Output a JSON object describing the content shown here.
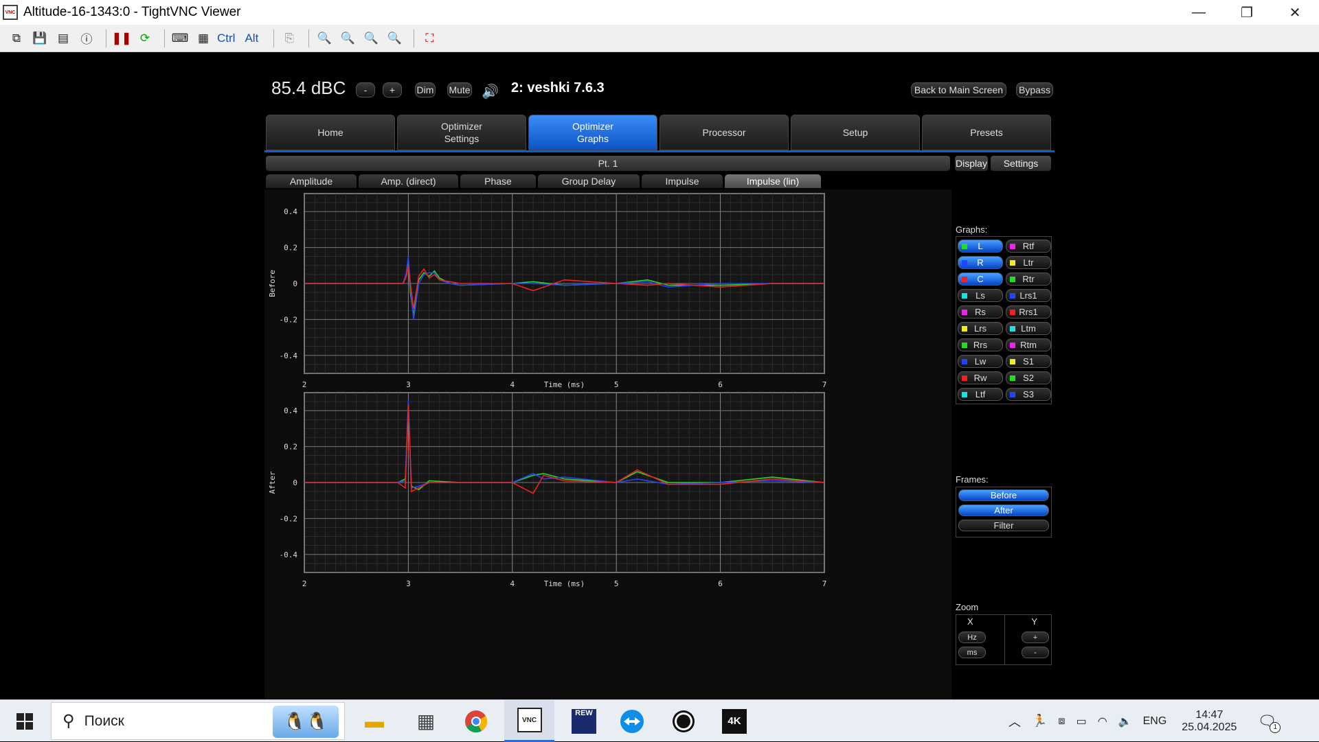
{
  "window": {
    "title": "Altitude-16-1343:0 - TightVNC Viewer",
    "minimize": "—",
    "restore": "❐",
    "close": "✕"
  },
  "vnc_toolbar": {
    "ctrl_label": "Ctrl",
    "alt_label": "Alt"
  },
  "header": {
    "volume": "85.4 dBC",
    "minus": "-",
    "plus": "+",
    "dim": "Dim",
    "mute": "Mute",
    "preset": "2: veshki 7.6.3",
    "back": "Back to Main Screen",
    "bypass": "Bypass"
  },
  "nav_tabs": [
    "Home",
    "Optimizer\nSettings",
    "Optimizer\nGraphs",
    "Processor",
    "Setup",
    "Presets"
  ],
  "active_nav": "Optimizer\nGraphs",
  "point_label": "Pt. 1",
  "right_tabs": {
    "display": "Display",
    "settings": "Settings"
  },
  "graph_tabs": [
    "Amplitude",
    "Amp. (direct)",
    "Phase",
    "Group Delay",
    "Impulse",
    "Impulse (lin)"
  ],
  "active_graph_tab": "Impulse (lin)",
  "graphs_panel": {
    "label": "Graphs:",
    "left": [
      {
        "name": "L",
        "color": "#22dd22",
        "on": true
      },
      {
        "name": "R",
        "color": "#2244ff",
        "on": true
      },
      {
        "name": "C",
        "color": "#ee2222",
        "on": true
      },
      {
        "name": "Ls",
        "color": "#22dddd",
        "on": false
      },
      {
        "name": "Rs",
        "color": "#ee22ee",
        "on": false
      },
      {
        "name": "Lrs",
        "color": "#eeee22",
        "on": false
      },
      {
        "name": "Rrs",
        "color": "#22dd22",
        "on": false
      },
      {
        "name": "Lw",
        "color": "#2244ff",
        "on": false
      },
      {
        "name": "Rw",
        "color": "#ee2222",
        "on": false
      },
      {
        "name": "Ltf",
        "color": "#22dddd",
        "on": false
      }
    ],
    "right": [
      {
        "name": "Rtf",
        "color": "#ee22ee",
        "on": false
      },
      {
        "name": "Ltr",
        "color": "#eeee22",
        "on": false
      },
      {
        "name": "Rtr",
        "color": "#22dd22",
        "on": false
      },
      {
        "name": "Lrs1",
        "color": "#2244ff",
        "on": false
      },
      {
        "name": "Rrs1",
        "color": "#ee2222",
        "on": false
      },
      {
        "name": "Ltm",
        "color": "#22dddd",
        "on": false
      },
      {
        "name": "Rtm",
        "color": "#ee22ee",
        "on": false
      },
      {
        "name": "S1",
        "color": "#eeee22",
        "on": false
      },
      {
        "name": "S2",
        "color": "#22dd22",
        "on": false
      },
      {
        "name": "S3",
        "color": "#2244ff",
        "on": false
      }
    ]
  },
  "frames_panel": {
    "label": "Frames:",
    "items": [
      {
        "name": "Before",
        "on": true
      },
      {
        "name": "After",
        "on": true
      },
      {
        "name": "Filter",
        "on": false
      }
    ]
  },
  "zoom_panel": {
    "label": "Zoom",
    "x": "X",
    "y": "Y",
    "hz": "Hz",
    "ms": "ms",
    "yplus": "+",
    "yminus": "-"
  },
  "chart_data": [
    {
      "type": "line",
      "ylabel": "Before",
      "xlabel": "Time (ms)",
      "xlim": [
        2,
        7
      ],
      "ylim": [
        -0.5,
        0.5
      ],
      "xticks": [
        "2",
        "3",
        "4",
        "5",
        "6",
        "7"
      ],
      "yticks": [
        "0.4",
        "0.2",
        "0",
        "-0.2",
        "-0.4"
      ],
      "grid": true,
      "series": [
        {
          "color": "#22dd22",
          "x": [
            2.0,
            2.95,
            2.98,
            3.0,
            3.02,
            3.05,
            3.1,
            3.15,
            3.2,
            3.25,
            3.3,
            3.4,
            3.5,
            4.0,
            4.2,
            4.5,
            5.0,
            5.3,
            5.5,
            6.0,
            6.5,
            7.0
          ],
          "y": [
            0.0,
            0.0,
            0.05,
            0.12,
            -0.05,
            -0.18,
            0.02,
            0.06,
            0.04,
            0.07,
            0.03,
            0.0,
            -0.01,
            0.0,
            0.01,
            -0.01,
            0.0,
            0.02,
            -0.01,
            -0.01,
            0.0,
            0.0
          ]
        },
        {
          "color": "#2244ff",
          "x": [
            2.0,
            2.95,
            2.98,
            3.0,
            3.02,
            3.05,
            3.1,
            3.15,
            3.2,
            3.25,
            3.3,
            3.4,
            3.5,
            4.0,
            4.2,
            4.5,
            5.0,
            5.3,
            5.5,
            6.0,
            6.5,
            7.0
          ],
          "y": [
            0.0,
            0.0,
            0.06,
            0.15,
            -0.02,
            -0.2,
            0.0,
            0.05,
            0.06,
            0.06,
            0.02,
            0.0,
            -0.01,
            0.0,
            0.0,
            -0.01,
            0.0,
            0.01,
            -0.02,
            0.0,
            0.0,
            0.0
          ]
        },
        {
          "color": "#ee2222",
          "x": [
            2.0,
            2.95,
            2.98,
            3.0,
            3.02,
            3.05,
            3.1,
            3.15,
            3.2,
            3.25,
            3.3,
            3.4,
            3.5,
            4.0,
            4.2,
            4.5,
            5.0,
            5.3,
            5.5,
            6.0,
            6.5,
            7.0
          ],
          "y": [
            0.0,
            0.0,
            0.04,
            0.1,
            0.0,
            -0.14,
            0.04,
            0.08,
            0.03,
            0.05,
            0.02,
            0.01,
            0.0,
            0.0,
            -0.04,
            0.02,
            0.0,
            -0.01,
            0.0,
            -0.02,
            0.0,
            0.0
          ]
        }
      ]
    },
    {
      "type": "line",
      "ylabel": "After",
      "xlabel": "Time (ms)",
      "xlim": [
        2,
        7
      ],
      "ylim": [
        -0.5,
        0.5
      ],
      "xticks": [
        "2",
        "3",
        "4",
        "5",
        "6",
        "7"
      ],
      "yticks": [
        "0.4",
        "0.2",
        "0",
        "-0.2",
        "-0.4"
      ],
      "grid": true,
      "series": [
        {
          "color": "#22dd22",
          "x": [
            2.0,
            2.9,
            2.97,
            3.0,
            3.03,
            3.1,
            3.2,
            3.5,
            4.0,
            4.2,
            4.3,
            4.5,
            5.0,
            5.2,
            5.5,
            6.0,
            6.5,
            7.0
          ],
          "y": [
            0.0,
            0.0,
            0.02,
            0.4,
            -0.02,
            -0.04,
            0.01,
            0.0,
            0.0,
            0.04,
            0.05,
            0.02,
            0.0,
            0.06,
            0.0,
            0.0,
            0.03,
            0.0
          ]
        },
        {
          "color": "#2244ff",
          "x": [
            2.0,
            2.9,
            2.97,
            3.0,
            3.03,
            3.1,
            3.2,
            3.5,
            4.0,
            4.2,
            4.3,
            4.5,
            5.0,
            5.2,
            5.5,
            6.0,
            6.5,
            7.0
          ],
          "y": [
            0.0,
            0.0,
            0.01,
            0.46,
            -0.03,
            -0.02,
            0.0,
            0.0,
            0.0,
            0.05,
            0.02,
            0.03,
            0.0,
            0.02,
            -0.01,
            0.0,
            0.01,
            0.0
          ]
        },
        {
          "color": "#ee2222",
          "x": [
            2.0,
            2.9,
            2.97,
            3.0,
            3.03,
            3.1,
            3.2,
            3.5,
            4.0,
            4.2,
            4.3,
            4.5,
            5.0,
            5.2,
            5.5,
            6.0,
            6.5,
            7.0
          ],
          "y": [
            0.0,
            0.0,
            -0.03,
            0.43,
            -0.05,
            -0.03,
            0.0,
            0.0,
            0.0,
            -0.06,
            0.04,
            0.01,
            0.0,
            0.07,
            -0.01,
            -0.01,
            0.02,
            0.0
          ]
        }
      ]
    }
  ],
  "taskbar": {
    "search_placeholder": "Поиск",
    "lang": "ENG",
    "time": "14:47",
    "date": "25.04.2025",
    "notif_count": "1",
    "rew_label": "REW",
    "vortex_label": "4K"
  }
}
